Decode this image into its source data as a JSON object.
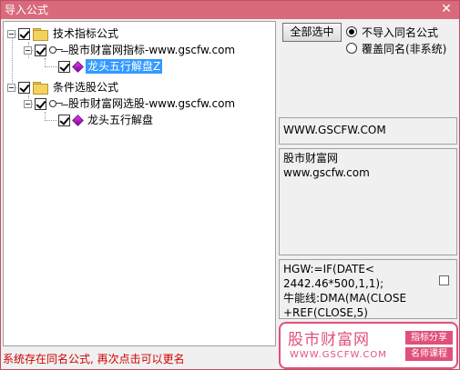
{
  "window": {
    "title": "导入公式",
    "close_glyph": "✕"
  },
  "tree": {
    "nodes": [
      {
        "label": "技术指标公式",
        "icon": "folder-icon",
        "checked": true
      },
      {
        "label": "股市财富网指标-www.gscfw.com",
        "icon": "key-icon",
        "checked": true
      },
      {
        "label": "龙头五行解盘Z",
        "icon": "formula-diamond-icon",
        "checked": true,
        "selected": true
      },
      {
        "label": "条件选股公式",
        "icon": "folder-icon",
        "checked": true
      },
      {
        "label": "股市财富网选股-www.gscfw.com",
        "icon": "key-icon",
        "checked": true
      },
      {
        "label": "龙头五行解盘",
        "icon": "formula-diamond-icon",
        "checked": true
      }
    ]
  },
  "options": {
    "select_all_label": "全部选中",
    "radio_skip_label": "不导入同名公式",
    "radio_overwrite_label": "覆盖同名(非系统)",
    "selected": "skip"
  },
  "info": {
    "source": "WWW.GSCFW.COM",
    "description": "股市财富网\nwww.gscfw.com",
    "formula_text": "HGW:=IF(DATE<\n2442.46*500,1,1);\n牛能线:DMA(MA(CLOSE\n+REF(CLOSE,5)"
  },
  "status": {
    "message": "系统存在同名公式, 再次点击可以更名"
  },
  "brand": {
    "name": "股市财富网",
    "url": "WWW.GSCFW.COM",
    "tag_top": "指标分享",
    "tag_bottom": "名师课程",
    "accent": "#e0507a"
  }
}
